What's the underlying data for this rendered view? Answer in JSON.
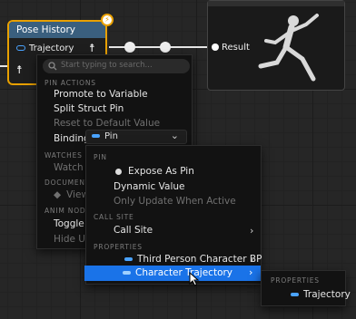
{
  "node": {
    "title": "Pose History",
    "pins": {
      "trajectory": "Trajectory"
    }
  },
  "output": {
    "pin": "Result"
  },
  "menu": {
    "search_placeholder": "Start typing to search...",
    "pin_actions_header": "PIN ACTIONS",
    "promote": "Promote to Variable",
    "split": "Split Struct Pin",
    "reset": "Reset to Default Value",
    "binding_label": "Binding",
    "binding_value": "Pin",
    "watches_header": "WATCHES",
    "watch": "Watch T",
    "documentation_header": "DOCUMENT",
    "view": "View",
    "anim_node_header": "ANIM NODE",
    "toggle": "Toggle F",
    "hide": "Hide Unl"
  },
  "submenu": {
    "pin_header": "PIN",
    "expose": "Expose As Pin",
    "dynamic": "Dynamic Value",
    "only_update": "Only Update When Active",
    "call_site_header": "CALL SITE",
    "call_site": "Call Site",
    "properties_header": "PROPERTIES",
    "third_person": "Third Person Character BP",
    "char_traj": "Character Trajectory"
  },
  "submenu2": {
    "properties_header": "PROPERTIES",
    "trajectory": "Trajectory"
  },
  "colors": {
    "accent": "#1a73e8",
    "node_border": "#e8a000",
    "pin_blue": "#4aa3ff"
  }
}
